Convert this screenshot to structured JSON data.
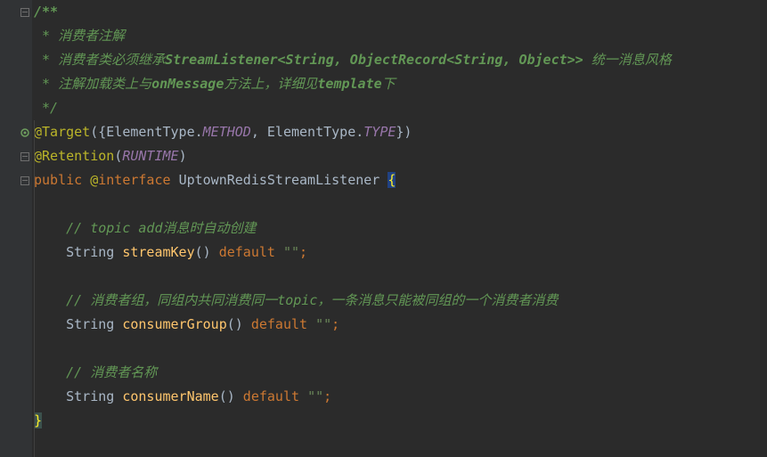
{
  "code": {
    "javadoc_start": "/**",
    "javadoc_line1": " * 消费者注解",
    "javadoc_line2_prefix": " * 消费者类必须继承",
    "javadoc_line2_class": "StreamListener",
    "javadoc_line2_generic": "<String, ObjectRecord<String, Object>>",
    "javadoc_line2_suffix": " 统一消息风格",
    "javadoc_line3_prefix": " * 注解加载类上与",
    "javadoc_line3_method": "onMessage",
    "javadoc_line3_mid": "方法上，详细见",
    "javadoc_line3_tmpl": "template",
    "javadoc_line3_suffix": "下",
    "javadoc_end": " */",
    "anno_target": "@Target",
    "target_open": "({",
    "elem_type1": "ElementType.",
    "method_const": "METHOD",
    "comma": ", ",
    "elem_type2": "ElementType.",
    "type_const": "TYPE",
    "target_close": "})",
    "anno_retention": "@Retention",
    "retention_open": "(",
    "runtime_const": "RUNTIME",
    "retention_close": ")",
    "public_kw": "public ",
    "at_interface": "@interface",
    "space": " ",
    "interface_name": "UptownRedisStreamListener",
    "open_brace": " {",
    "comment_topic": "// topic add消息时自动创建",
    "string_type": "String ",
    "method_streamkey": "streamKey",
    "parens": "()",
    "default_kw": " default ",
    "empty_string": "\"\"",
    "semicolon": ";",
    "comment_group": "// 消费者组，同组内共同消费同一topic，一条消息只能被同组的一个消费者消费",
    "method_consumergroup": "consumerGroup",
    "comment_name": "// 消费者名称",
    "method_consumername": "consumerName",
    "close_brace": "}"
  }
}
